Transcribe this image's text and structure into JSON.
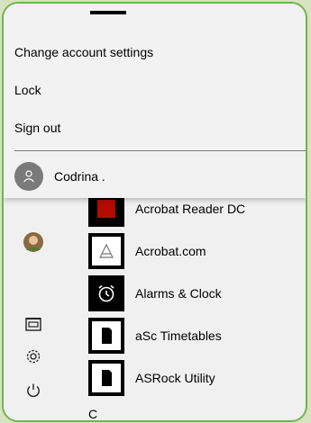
{
  "account_menu": {
    "change_settings": "Change account settings",
    "lock": "Lock",
    "sign_out": "Sign out",
    "user_name": "Codrina ."
  },
  "apps": [
    {
      "label": "Acrobat Reader DC",
      "icon": "acrobat-reader-icon"
    },
    {
      "label": "Acrobat.com",
      "icon": "acrobat-com-icon"
    },
    {
      "label": "Alarms & Clock",
      "icon": "alarm-clock-icon"
    },
    {
      "label": "aSc Timetables",
      "icon": "document-icon"
    },
    {
      "label": "ASRock Utility",
      "icon": "document-icon"
    },
    {
      "label": "C",
      "icon": ""
    }
  ],
  "sidebar_icons": [
    "user-avatar-icon",
    "documents-icon",
    "settings-gear-icon",
    "power-icon"
  ],
  "colors": {
    "frame_border": "#6db64c",
    "background": "#d8e3c1",
    "tile": "#000000"
  }
}
